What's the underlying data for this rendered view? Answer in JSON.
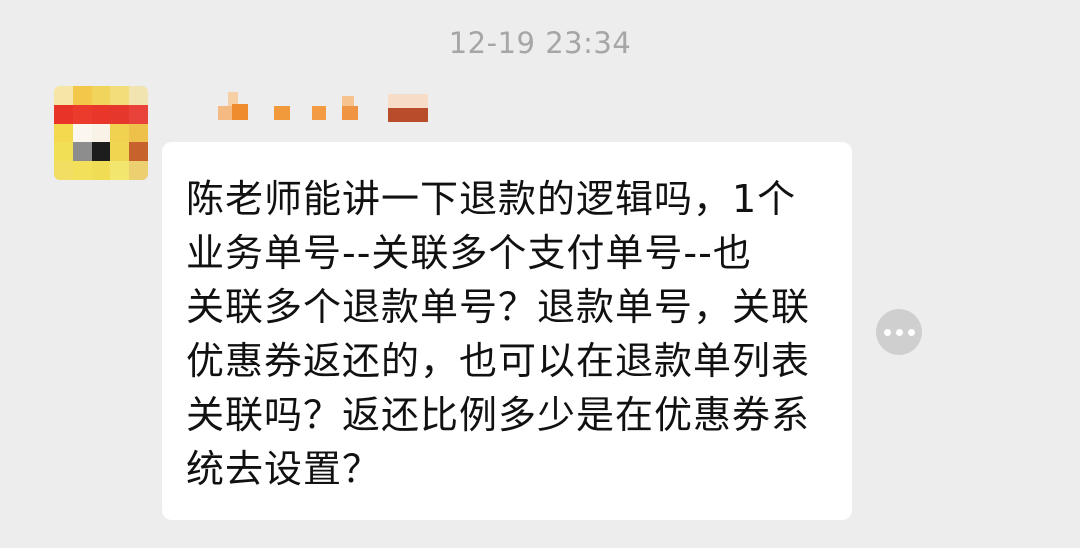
{
  "chat": {
    "timestamp": "12-19 23:34",
    "message": {
      "text_lines": [
        "陈老师能讲一下退款的逻辑吗，1个",
        "业务单号--关联多个支付单号--也",
        "关联多个退款单号？退款单号，关联",
        "优惠券返还的，也可以在退款单列表",
        "关联吗？返还比例多少是在优惠券系",
        "统去设置？"
      ]
    },
    "more_icon": "ellipsis-icon"
  },
  "colors": {
    "background": "#ededed",
    "bubble": "#ffffff",
    "timestamp": "#a6a6a6",
    "more_button": "#cfcfcf"
  }
}
